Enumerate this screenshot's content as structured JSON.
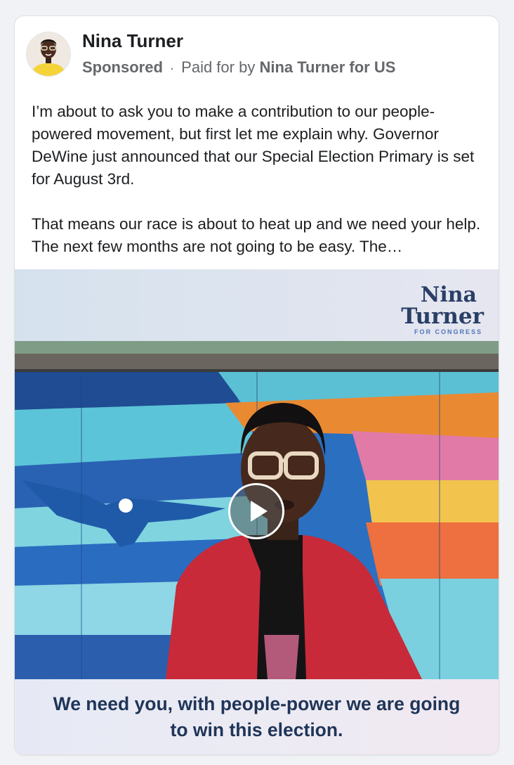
{
  "post": {
    "author": "Nina Turner",
    "sponsored_label": "Sponsored",
    "separator": "·",
    "paid_for_prefix": "Paid for by",
    "payer": "Nina Turner for US",
    "paragraphs": [
      "I’m about to ask you to make a contribution to our people-powered movement, but first let me explain why. Governor DeWine just announced that our Special Election Primary is set for August 3rd.",
      "That means our race is about to heat up and we need your help. The next few months are not going to be easy. The…"
    ]
  },
  "video": {
    "logo_line1": "Nina",
    "logo_line2": "Turner",
    "logo_line3": "FOR CONGRESS",
    "caption_line1": "We need you, with people-power we are going",
    "caption_line2": "to win this election.",
    "play_icon": "play-icon"
  },
  "colors": {
    "caption_text": "#1f3558",
    "logo_text": "#2a3f66",
    "author_text": "#1c1e21",
    "meta_text": "#65676b"
  }
}
